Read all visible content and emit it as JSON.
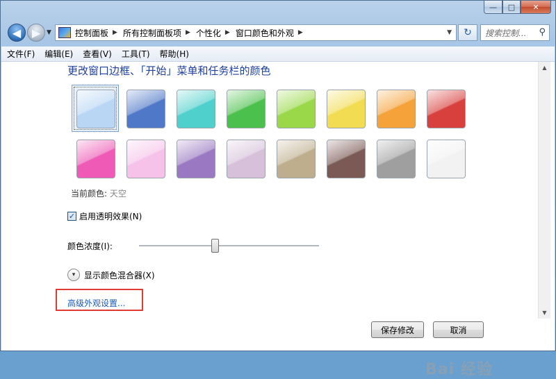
{
  "window": {
    "controls": {
      "min": "—",
      "max": "□",
      "close": "✕"
    }
  },
  "nav": {
    "back_icon": "◀",
    "forward_icon": "▶",
    "history_icon": "▼",
    "breadcrumbs": [
      "控制面板",
      "所有控制面板项",
      "个性化",
      "窗口颜色和外观"
    ],
    "crumb_sep": "▶",
    "address_dropdown": "▼",
    "refresh_icon": "↻",
    "search_placeholder": "搜索控制...",
    "search_icon": "⚲"
  },
  "menu": [
    "文件(F)",
    "编辑(E)",
    "查看(V)",
    "工具(T)",
    "帮助(H)"
  ],
  "page": {
    "title": "更改窗口边框、「开始」菜单和任务栏的颜色",
    "current_color_label": "当前颜色: ",
    "current_color_value": "天空",
    "transparency_check": "✓",
    "transparency_label": "启用透明效果(N)",
    "intensity_label": "颜色浓度(I):",
    "intensity_value": 0.42,
    "expander_icon": "▾",
    "mixer_label": "显示颜色混合器(X)",
    "advanced_link": "高级外观设置...",
    "save_button": "保存修改",
    "cancel_button": "取消",
    "scroll_up": "▲",
    "scroll_down": "▼",
    "watermark": "Bai  经验"
  },
  "swatches": [
    {
      "color": "#b9d6f5",
      "selected": true
    },
    {
      "color": "#4f78c8"
    },
    {
      "color": "#4fd0cc"
    },
    {
      "color": "#4cc04c"
    },
    {
      "color": "#9ad84a"
    },
    {
      "color": "#f2dc52"
    },
    {
      "color": "#f5a23a"
    },
    {
      "color": "#d8403e"
    },
    {
      "color": "#ee5ab5"
    },
    {
      "color": "#f6c2ea"
    },
    {
      "color": "#9a78c2"
    },
    {
      "color": "#d6c0da"
    },
    {
      "color": "#bfae8e"
    },
    {
      "color": "#7b5a55"
    },
    {
      "color": "#9f9f9f"
    },
    {
      "color": "#f2f2f2"
    }
  ]
}
